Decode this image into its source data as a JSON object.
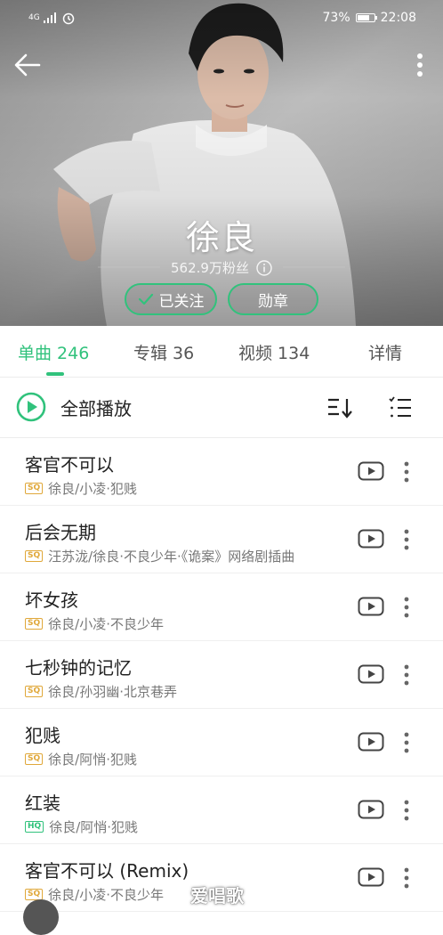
{
  "status_bar": {
    "network": "4G",
    "battery_percent": "73%",
    "battery_level": 0.73,
    "time": "22:08"
  },
  "artist": {
    "name": "徐良",
    "fans": "562.9万粉丝",
    "follow_label": "已关注",
    "medal_label": "勋章"
  },
  "tabs": [
    {
      "label": "单曲 246",
      "active": true
    },
    {
      "label": "专辑 36",
      "active": false
    },
    {
      "label": "视频 134",
      "active": false
    },
    {
      "label": "详情",
      "active": false
    }
  ],
  "play_all": {
    "label": "全部播放"
  },
  "songs": [
    {
      "title": "客官不可以",
      "quality": "SQ",
      "subtitle": "徐良/小凌·犯贱"
    },
    {
      "title": "后会无期",
      "quality": "SQ",
      "subtitle": "汪苏泷/徐良·不良少年·《诡案》网络剧插曲"
    },
    {
      "title": "坏女孩",
      "quality": "SQ",
      "subtitle": "徐良/小凌·不良少年"
    },
    {
      "title": "七秒钟的记忆",
      "quality": "SQ",
      "subtitle": "徐良/孙羽幽·北京巷弄"
    },
    {
      "title": "犯贱",
      "quality": "SQ",
      "subtitle": "徐良/阿悄·犯贱"
    },
    {
      "title": "红装",
      "quality": "HQ",
      "subtitle": "徐良/阿悄·犯贱"
    },
    {
      "title": "客官不可以 (Remix)",
      "quality": "SQ",
      "subtitle": "徐良/小凌·不良少年"
    }
  ],
  "watermark": "爱唱歌",
  "colors": {
    "accent": "#31c27c",
    "sq_badge": "#e0a83a",
    "hq_badge": "#31c27c"
  },
  "icons": [
    "back-arrow-icon",
    "more-vertical-icon",
    "info-icon",
    "check-icon",
    "play-circle-icon",
    "sort-icon",
    "multi-select-icon",
    "mv-play-icon"
  ]
}
